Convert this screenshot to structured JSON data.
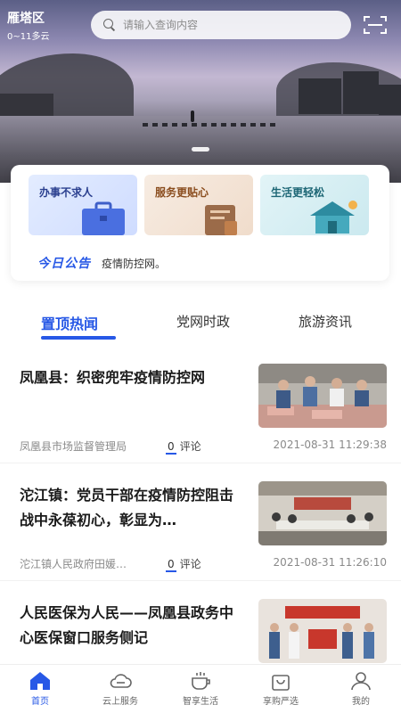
{
  "header": {
    "district": "雁塔区",
    "weather": "0~11多云",
    "search_placeholder": "请输入查询内容"
  },
  "services": [
    {
      "label": "办事不求人",
      "icon": "briefcase-icon"
    },
    {
      "label": "服务更贴心",
      "icon": "document-icon"
    },
    {
      "label": "生活更轻松",
      "icon": "house-icon"
    }
  ],
  "notice": {
    "title": "今日公告",
    "text": "疫情防控网。"
  },
  "tabs": [
    {
      "label": "置顶热闻",
      "active": true
    },
    {
      "label": "党网时政",
      "active": false
    },
    {
      "label": "旅游资讯",
      "active": false
    }
  ],
  "news": [
    {
      "title": "凤凰县：织密兜牢疫情防控网",
      "source": "凤凰县市场监督管理局",
      "comments": "0",
      "comment_label": "评论",
      "time": "2021-08-31 11:29:38"
    },
    {
      "title": "沱江镇：党员干部在疫情防控阻击战中永葆初心，彰显为…",
      "source": "沱江镇人民政府田媛…",
      "comments": "0",
      "comment_label": "评论",
      "time": "2021-08-31 11:26:10"
    },
    {
      "title": "人民医保为人民——凤凰县政务中心医保窗口服务侧记"
    }
  ],
  "bottom_nav": [
    {
      "label": "首页",
      "icon": "home-icon",
      "active": true
    },
    {
      "label": "云上服务",
      "icon": "cloud-service-icon",
      "active": false
    },
    {
      "label": "智享生活",
      "icon": "cup-icon",
      "active": false
    },
    {
      "label": "享购严选",
      "icon": "shopping-bag-icon",
      "active": false
    },
    {
      "label": "我的",
      "icon": "user-icon",
      "active": false
    }
  ],
  "colors": {
    "accent": "#2758e6",
    "text": "#1a1a1a",
    "meta": "#8a8a8a"
  }
}
